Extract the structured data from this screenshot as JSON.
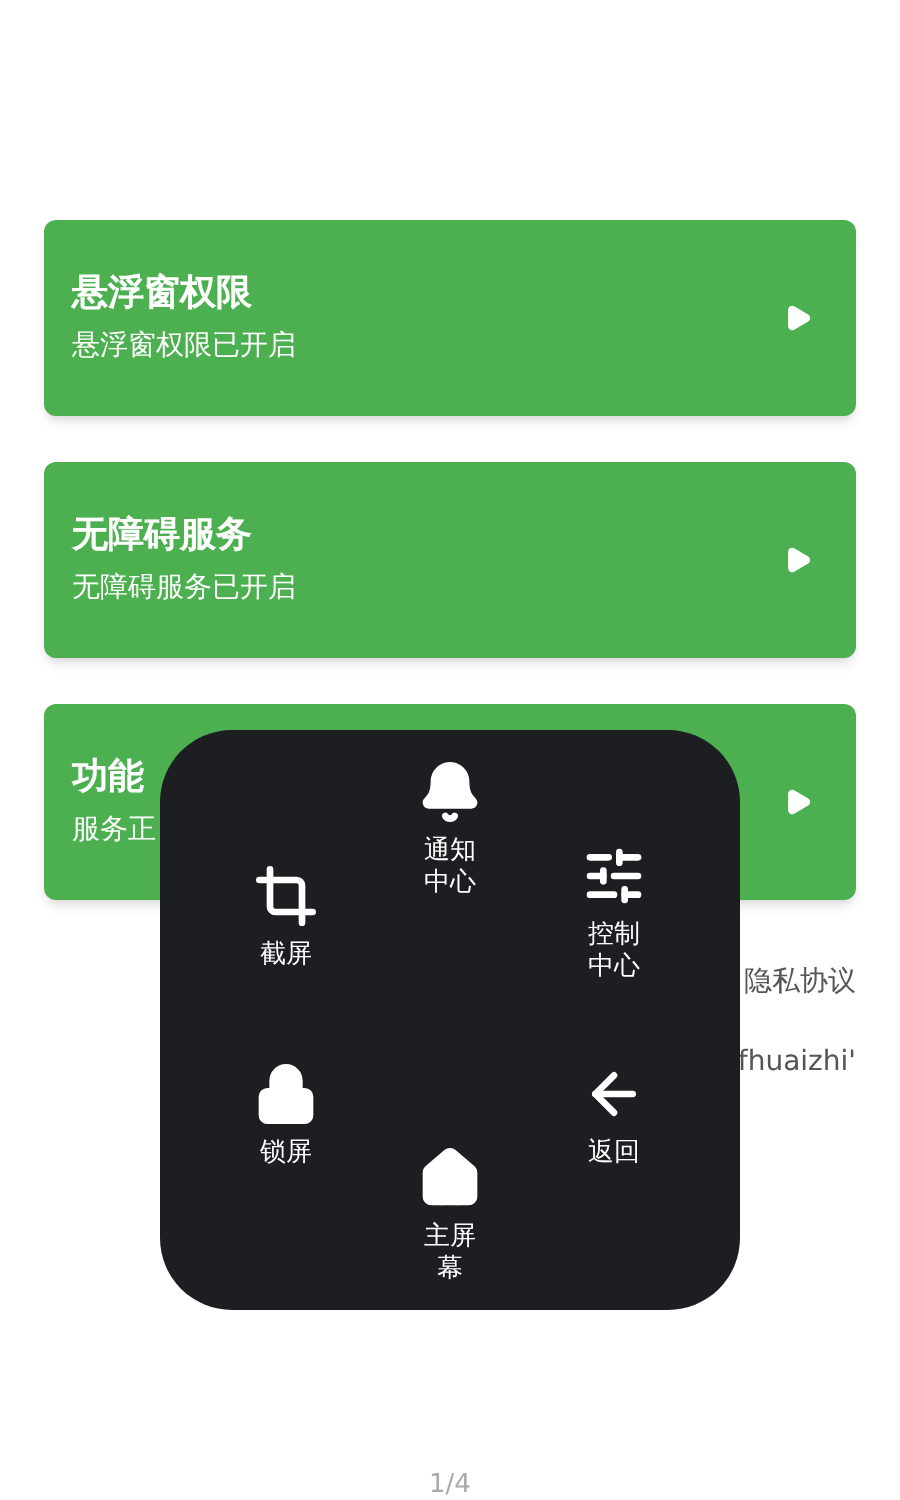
{
  "cards": [
    {
      "title": "悬浮窗权限",
      "subtitle": "悬浮窗权限已开启"
    },
    {
      "title": "无障碍服务",
      "subtitle": "无障碍服务已开启"
    },
    {
      "title": "功能",
      "subtitle": "服务正"
    }
  ],
  "side_texts": [
    "隐私协议",
    "fhuaizhi'"
  ],
  "page_indicator": "1/4",
  "menu": {
    "items": [
      {
        "kind": "notify",
        "label": "通知中心"
      },
      {
        "kind": "screenshot",
        "label": "截屏"
      },
      {
        "kind": "control",
        "label": "控制中心"
      },
      {
        "kind": "lock",
        "label": "锁屏"
      },
      {
        "kind": "back",
        "label": "返回"
      },
      {
        "kind": "home",
        "label": "主屏幕"
      }
    ]
  }
}
